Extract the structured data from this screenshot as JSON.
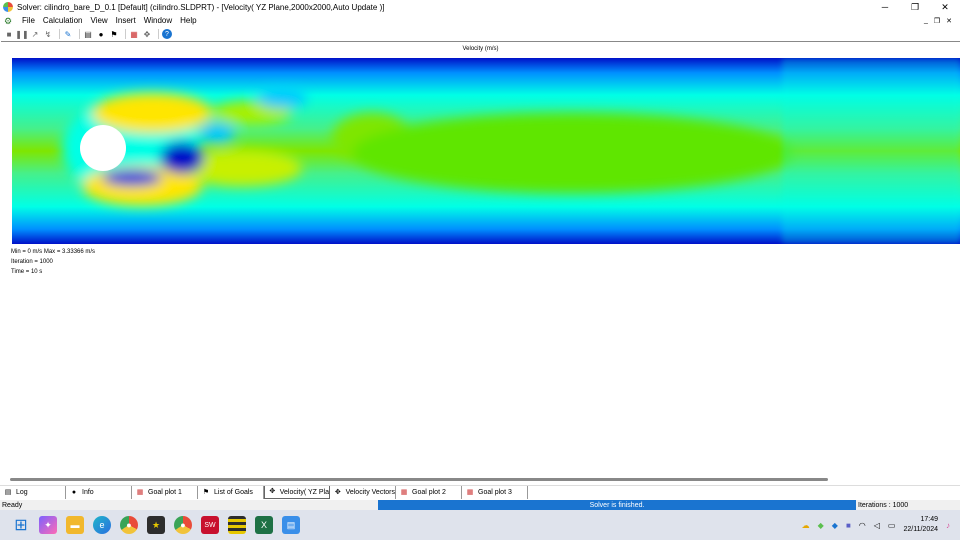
{
  "window": {
    "title": "Solver: cilindro_bare_D_0.1 [Default] (cilindro.SLDPRT) - [Velocity( YZ Plane,2000x2000,Auto Update )]",
    "controls": [
      "─",
      "❐",
      "✕"
    ]
  },
  "menu": {
    "items": [
      "File",
      "Calculation",
      "View",
      "Insert",
      "Window",
      "Help"
    ],
    "mdi_controls": [
      "_",
      "❐",
      "✕"
    ]
  },
  "toolbar": {
    "icons": [
      "stop-icon",
      "pause-icon",
      "run-icon",
      "step-icon",
      "pin-icon",
      "report-icon",
      "info-icon",
      "flag-icon",
      "plot-icon",
      "settings-icon",
      "help-icon"
    ]
  },
  "plot": {
    "title": "Velocity (m/s)",
    "min_max": "Min = 0 m/s   Max = 3.33366 m/s",
    "iteration": "Iteration = 1000",
    "time": "Time = 10 s"
  },
  "tabs": [
    {
      "label": "Log",
      "icon": "log-icon",
      "active": false
    },
    {
      "label": "Info",
      "icon": "info-icon",
      "active": false
    },
    {
      "label": "Goal plot 1",
      "icon": "goal-plot-icon",
      "active": false
    },
    {
      "label": "List of Goals",
      "icon": "goals-flag-icon",
      "active": false
    },
    {
      "label": "Velocity( YZ Pla",
      "icon": "velocity-icon",
      "active": true
    },
    {
      "label": "Velocity Vectors",
      "icon": "vectors-icon",
      "active": false
    },
    {
      "label": "Goal plot 2",
      "icon": "goal-plot-icon",
      "active": false
    },
    {
      "label": "Goal plot 3",
      "icon": "goal-plot-icon",
      "active": false
    }
  ],
  "status": {
    "ready": "Ready",
    "progress": "Solver is finished.",
    "iterations": "Iterations : 1000"
  },
  "taskbar": {
    "time": "17:49",
    "date": "22/11/2024"
  },
  "colors": {
    "accent": "#1a74d0",
    "field_low": "#0010c8",
    "field_mid": "#00ffe6",
    "field_high": "#7fe600"
  }
}
